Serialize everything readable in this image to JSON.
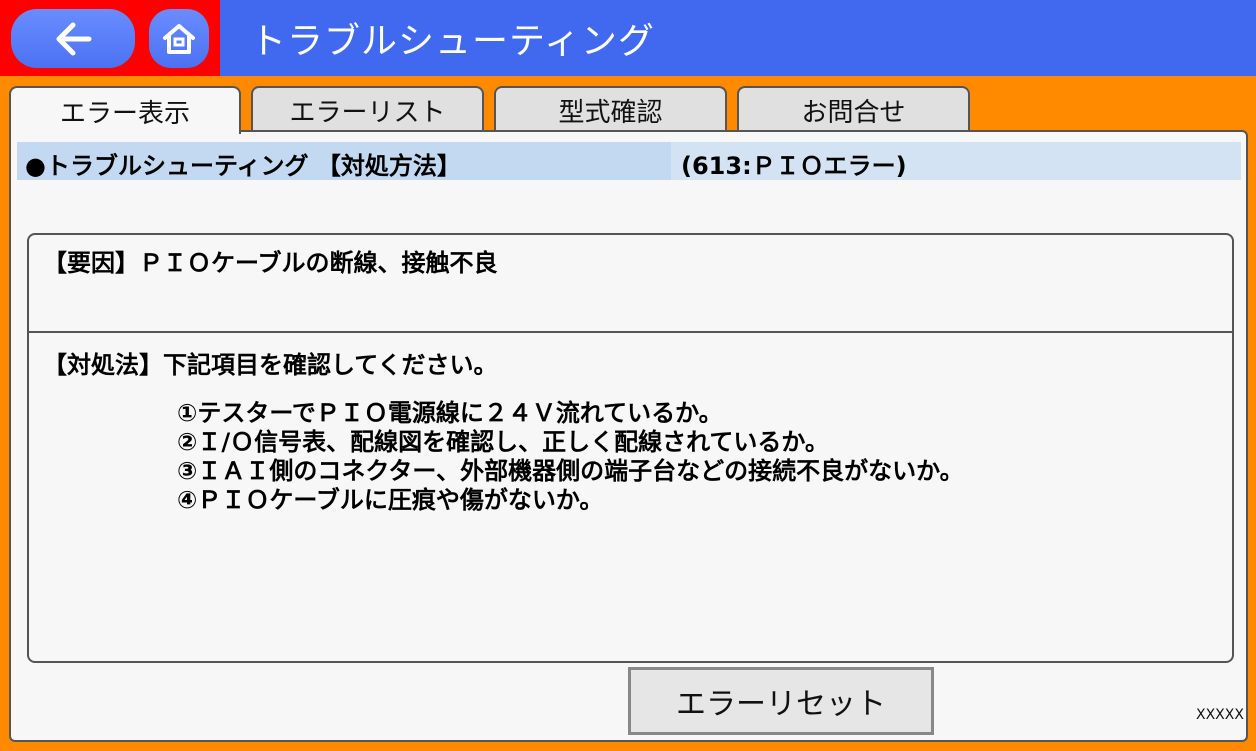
{
  "header": {
    "title": "トラブルシューティング",
    "back_icon": "arrow-left-icon",
    "home_icon": "home-icon",
    "highlight_color": "#ff0000",
    "bar_color": "#4169f0"
  },
  "tabs": [
    {
      "label": "エラー表示",
      "active": true
    },
    {
      "label": "エラーリスト",
      "active": false
    },
    {
      "label": "型式確認",
      "active": false
    },
    {
      "label": "お問合せ",
      "active": false
    }
  ],
  "info_bar": {
    "left": "●トラブルシューティング 【対処方法】",
    "right": "(613:ＰＩＯエラー)"
  },
  "content": {
    "cause": "【要因】ＰＩＯケーブルの断線、接触不良",
    "action_header": "【対処法】下記項目を確認してください。",
    "steps": [
      "①テスターでＰＩＯ電源線に２４Ｖ流れているか。",
      "②Ｉ/Ｏ信号表、配線図を確認し、正しく配線されているか。",
      "③ＩＡＩ側のコネクター、外部機器側の端子台などの接続不良がないか。",
      "④ＰＩＯケーブルに圧痕や傷がないか。"
    ]
  },
  "reset_button": {
    "label": "エラーリセット"
  },
  "footer_code": "XXXXX",
  "colors": {
    "background": "#ff8a00",
    "info_bar": "#c3d9f1"
  }
}
